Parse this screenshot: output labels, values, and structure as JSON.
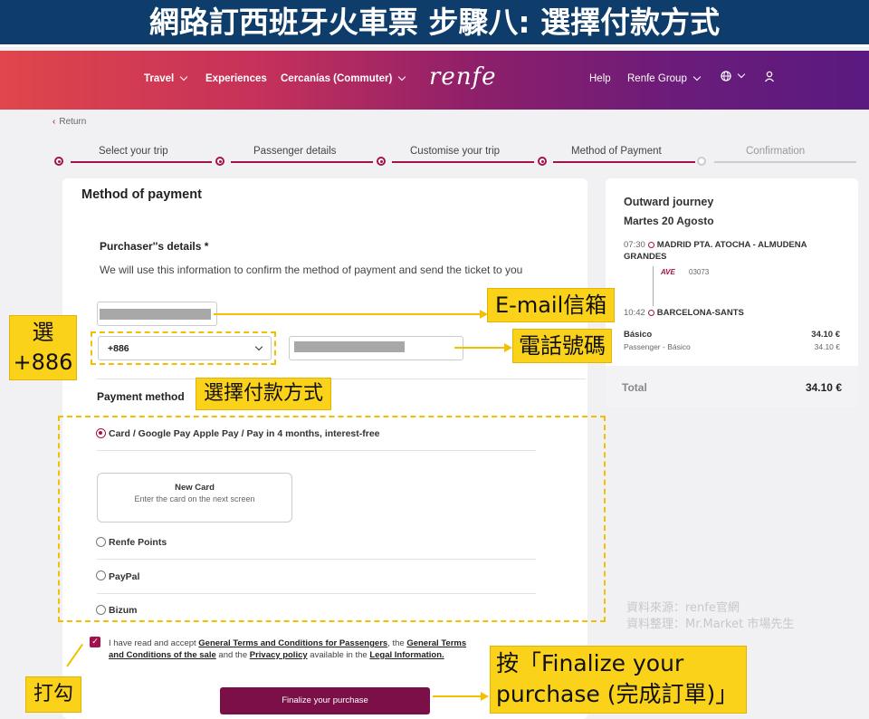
{
  "banner": {
    "title": "網路訂西班牙火車票 步驟八: 選擇付款方式"
  },
  "nav": {
    "items": [
      "Travel",
      "Experiences",
      "Cercanías (Commuter)",
      "Help",
      "Renfe Group"
    ],
    "logo": "renfe"
  },
  "return_label": "Return",
  "steps": [
    "Select your trip",
    "Passenger details",
    "Customise your trip",
    "Method of Payment",
    "Confirmation"
  ],
  "form": {
    "title": "Method of payment",
    "purchaser_heading": "Purchaser''s details *",
    "purchaser_info": "We will use this information to confirm the method of payment and send the ticket to you",
    "country_code": "+886",
    "payment_heading": "Payment method",
    "options": {
      "card": "Card / Google Pay Apple Pay / Pay in 4 months, interest-free",
      "points": "Renfe Points",
      "paypal": "PayPal",
      "bizum": "Bizum"
    },
    "new_card_title": "New Card",
    "new_card_sub": "Enter the card on the next screen",
    "terms": {
      "t1": "I have read and accept ",
      "l1": "General Terms and Conditions for Passengers",
      "t2": ", the ",
      "l2": "General Terms and Conditions of the sale",
      "t3": " and the ",
      "l3": "Privacy policy",
      "t4": " available in the ",
      "l4": "Legal Information."
    },
    "finalize": "Finalize your purchase"
  },
  "summary": {
    "title": "Outward journey",
    "date": "Martes 20 Agosto",
    "dep_time": "07:30",
    "dep_station": "MADRID PTA. ATOCHA - ALMUDENA GRANDES",
    "train_brand": "AVE",
    "train_number": "03073",
    "arr_time": "10:42",
    "arr_station": "BARCELONA-SANTS",
    "fare_name": "Básico",
    "fare_price": "34.10 €",
    "fare_desc": "Passenger - Básico",
    "fare_desc_price": "34.10 €",
    "total_label": "Total",
    "total_price": "34.10 €"
  },
  "annotations": {
    "email": "E-mail信箱",
    "phone": "電話號碼",
    "select_code": "選\n+886",
    "payment": "選擇付款方式",
    "tick": "打勾",
    "finalize": "按「Finalize your purchase (完成訂單)」"
  },
  "watermark": {
    "source": "資料來源：renfe官網",
    "compiled": "資料整理：Mr.Market 市場先生"
  },
  "colors": {
    "accent": "#a3124c",
    "banner": "#0f3d6b",
    "callout": "#fbd21a",
    "button": "#7a1047"
  }
}
